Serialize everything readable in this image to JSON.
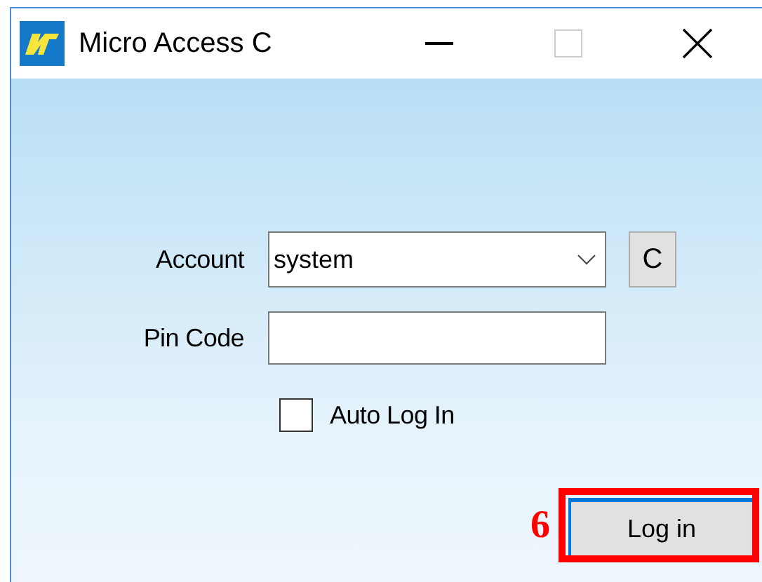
{
  "window": {
    "title": "Micro Access C"
  },
  "form": {
    "account": {
      "label": "Account",
      "value": "system"
    },
    "clear_button": "C",
    "pin": {
      "label": "Pin Code"
    },
    "auto_login": {
      "label": "Auto Log In",
      "checked": false
    }
  },
  "login_button": "Log in",
  "annotation": {
    "label": "6"
  }
}
